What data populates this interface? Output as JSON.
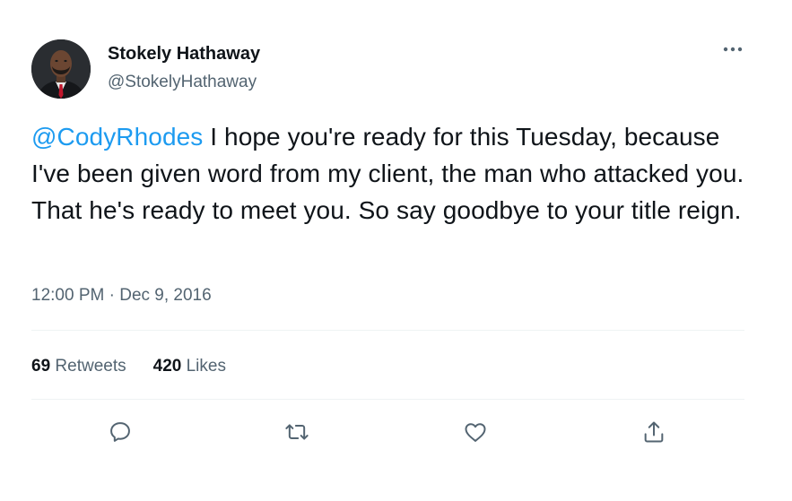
{
  "author": {
    "display_name": "Stokely Hathaway",
    "handle": "@StokelyHathaway",
    "avatar_icon": "avatar-photo-icon"
  },
  "tweet": {
    "mention": "@CodyRhodes",
    "body": " I hope you're ready for this Tuesday, because I've been given word from my client, the man who attacked you. That he's ready to meet you. So say goodbye to your title reign."
  },
  "meta": {
    "time": "12:00 PM",
    "separator": " · ",
    "date": "Dec 9, 2016"
  },
  "stats": {
    "retweets_count": "69",
    "retweets_label": " Retweets",
    "likes_count": "420",
    "likes_label": " Likes"
  },
  "actions": {
    "reply_icon": "reply-icon",
    "retweet_icon": "retweet-icon",
    "like_icon": "heart-icon",
    "share_icon": "share-icon"
  },
  "colors": {
    "accent": "#1d9bf0",
    "secondary_text": "#536471",
    "primary_text": "#0f1419",
    "divider": "#eff3f4"
  }
}
